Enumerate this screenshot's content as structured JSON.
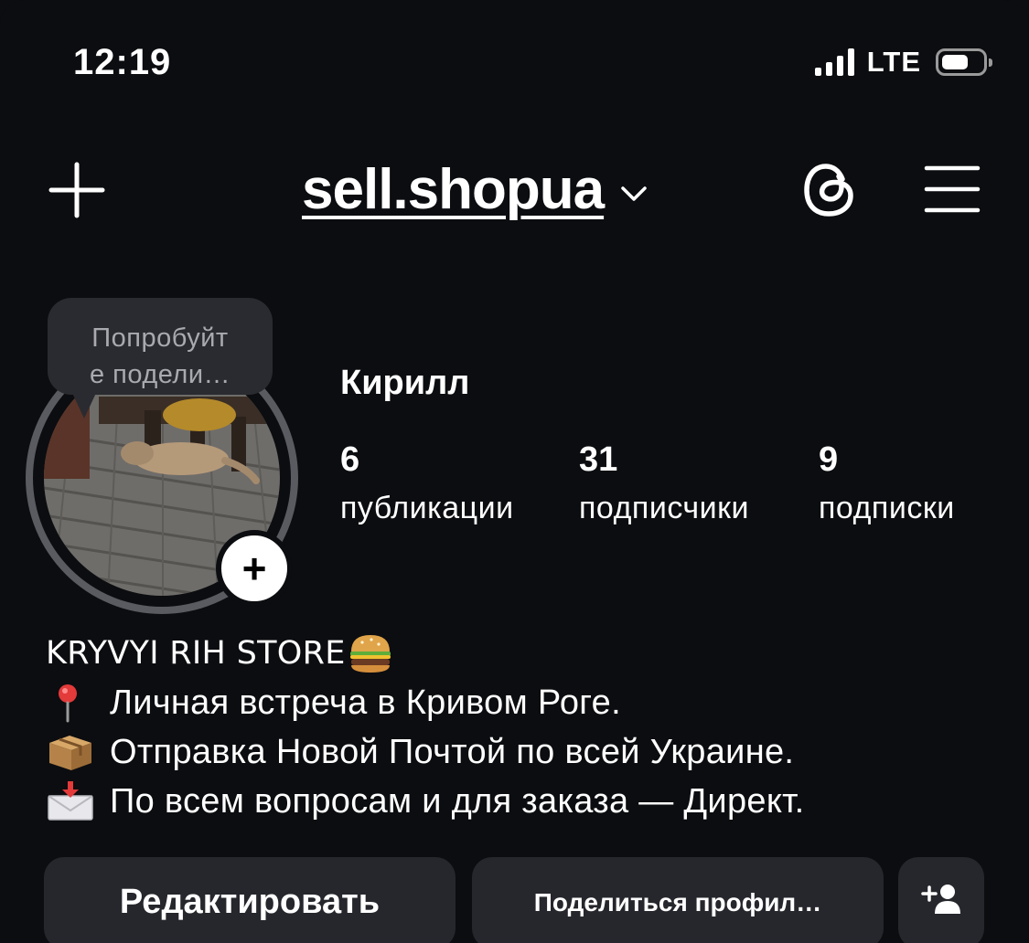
{
  "status_bar": {
    "time": "12:19",
    "network": "LTE"
  },
  "header": {
    "username": "sell.shopua",
    "icons": [
      "plus-icon",
      "chevron-down-icon",
      "threads-icon",
      "menu-icon"
    ]
  },
  "profile": {
    "tooltip_line1": "Попробуйт",
    "tooltip_line2": "е подели…",
    "name": "Кирилл",
    "stats": [
      {
        "value": "6",
        "label": "публикации"
      },
      {
        "value": "31",
        "label": "подписчики"
      },
      {
        "value": "9",
        "label": "подписки"
      }
    ]
  },
  "bio": {
    "title": "KRYVYI RIH STORE",
    "lines": [
      {
        "icon": "pushpin-icon",
        "text": "Личная встреча в Кривом Роге."
      },
      {
        "icon": "package-icon",
        "text": "Отправка Новой Почтой по всей Украине."
      },
      {
        "icon": "envelope-icon",
        "text": "По всем вопросам и для заказа — Директ."
      }
    ]
  },
  "buttons": {
    "edit": "Редактировать",
    "share": "Поделиться профил…"
  },
  "colors": {
    "background": "#0c0d10",
    "button": "#26272c",
    "tooltip": "#2a2b30"
  }
}
